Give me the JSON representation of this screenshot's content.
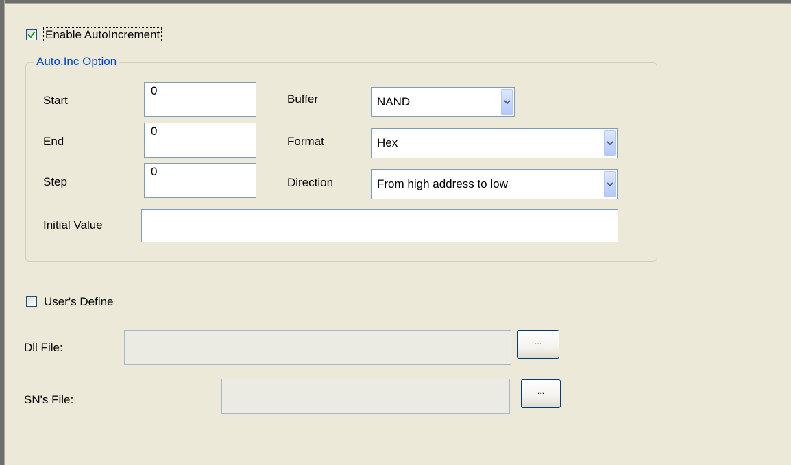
{
  "enable_autoincrement": {
    "label": "Enable AutoIncrement",
    "checked": true
  },
  "auto_inc_option": {
    "group_title": "Auto.Inc Option",
    "start": {
      "label": "Start",
      "value": "0"
    },
    "end": {
      "label": "End",
      "value": "0"
    },
    "step": {
      "label": "Step",
      "value": "0"
    },
    "initial_value": {
      "label": "Initial Value",
      "value": ""
    },
    "buffer": {
      "label": "Buffer",
      "selected": "NAND"
    },
    "format": {
      "label": "Format",
      "selected": "Hex"
    },
    "direction": {
      "label": "Direction",
      "selected": "From high address to low"
    }
  },
  "users_define": {
    "label": "User's Define",
    "checked": false
  },
  "dll_file": {
    "label": "Dll File:",
    "value": "",
    "browse_label": "..."
  },
  "sn_file": {
    "label": "SN's File:",
    "value": "",
    "browse_label": "..."
  },
  "colors": {
    "background": "#ece9d8",
    "group_title": "#0046d5",
    "checkmark": "#21a121",
    "input_border": "#7f9db9",
    "disabled_input": "#ebebe4"
  },
  "icons": {
    "checkbox_check": "checkmark-icon",
    "combo_arrow": "chevron-down-icon"
  }
}
